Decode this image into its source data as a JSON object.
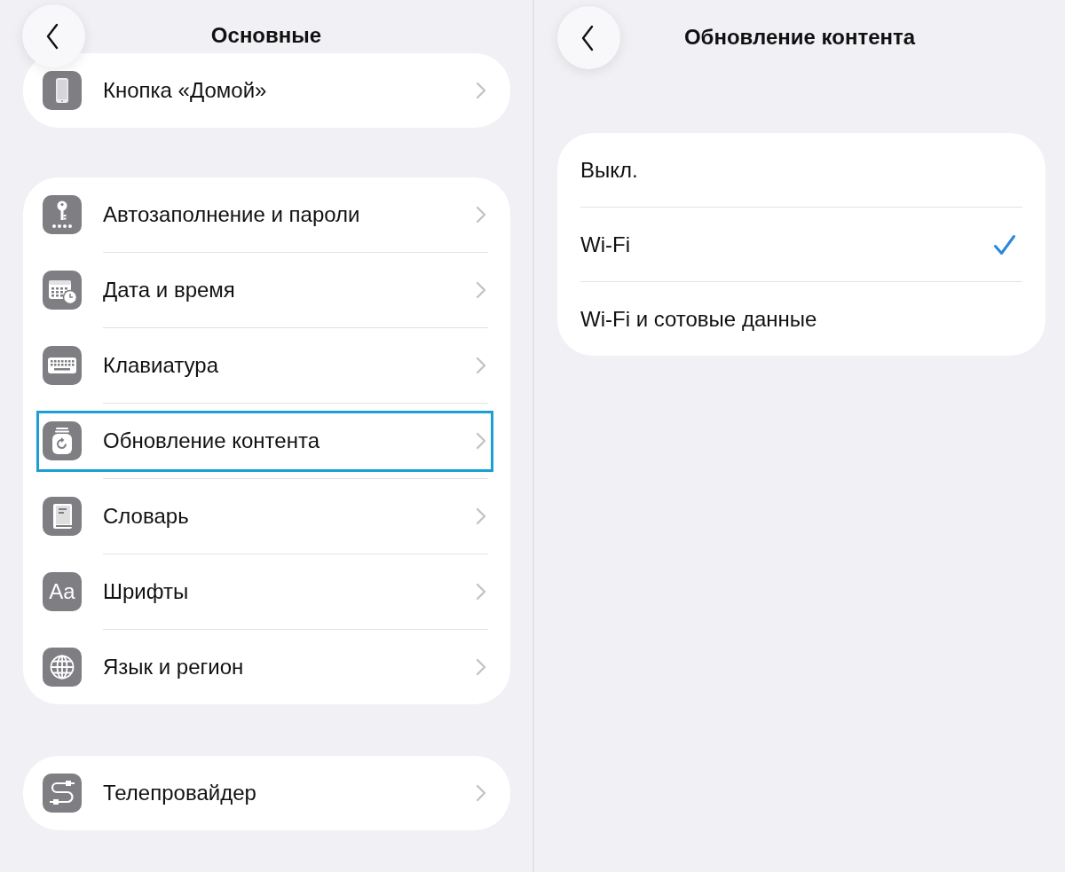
{
  "left_screen": {
    "title": "Основные",
    "groups": [
      {
        "items": [
          {
            "label": "Кнопка «Домой»",
            "highlighted": false
          }
        ]
      },
      {
        "items": [
          {
            "label": "Автозаполнение и пароли",
            "highlighted": false
          },
          {
            "label": "Дата и время",
            "highlighted": false
          },
          {
            "label": "Клавиатура",
            "highlighted": false
          },
          {
            "label": "Обновление контента",
            "highlighted": true
          },
          {
            "label": "Словарь",
            "highlighted": false
          },
          {
            "label": "Шрифты",
            "icon_text": "Aa",
            "highlighted": false
          },
          {
            "label": "Язык и регион",
            "highlighted": false
          }
        ]
      },
      {
        "items": [
          {
            "label": "Телепровайдер",
            "highlighted": false
          }
        ]
      }
    ]
  },
  "right_screen": {
    "title": "Обновление контента",
    "options": [
      {
        "label": "Выкл.",
        "selected": false
      },
      {
        "label": "Wi-Fi",
        "selected": true
      },
      {
        "label": "Wi-Fi и сотовые данные",
        "selected": false
      }
    ]
  }
}
